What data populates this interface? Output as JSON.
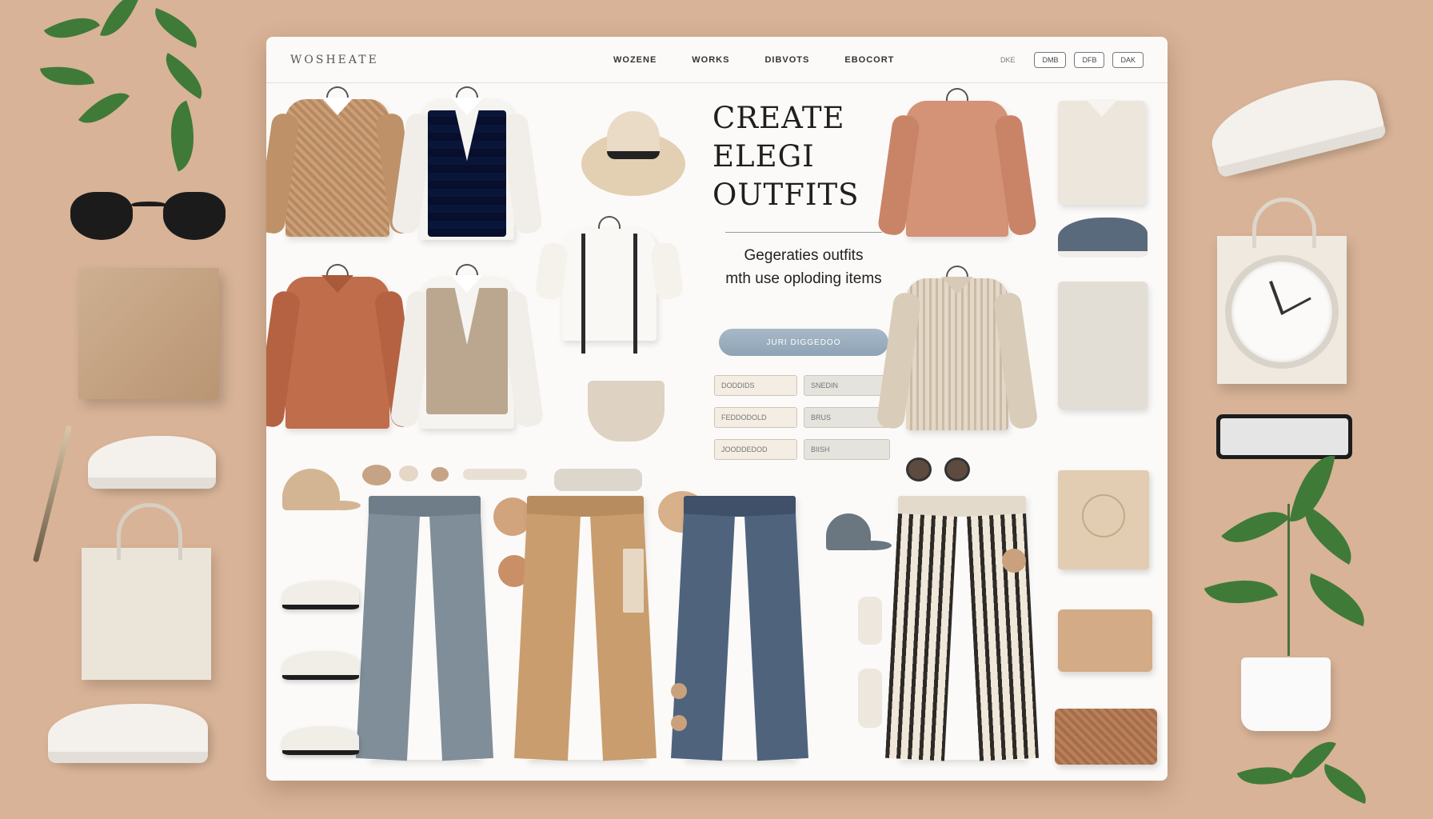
{
  "site": {
    "logo": "WOSHEATE",
    "nav_links": [
      "WOZENE",
      "WORKS",
      "DIBVOTS",
      "EBOCORT"
    ],
    "lang_label": "DKE",
    "header_buttons": [
      "DMB",
      "DFB",
      "DAK"
    ]
  },
  "hero": {
    "title_lines": [
      "CREATE",
      "ELEGI",
      "OUTFITS"
    ],
    "subtitle_lines": [
      "Gegeraties outfits",
      "mth use oploding items"
    ],
    "cta_label": "JURI DIGGEDOO"
  },
  "form": {
    "fields": [
      {
        "placeholder": "DODDIDS"
      },
      {
        "placeholder": "SNEDIN"
      },
      {
        "placeholder": "FEDDODOLD"
      },
      {
        "placeholder": "BRUS"
      },
      {
        "placeholder": "JOODDEDOD"
      },
      {
        "placeholder": "BIISH"
      }
    ]
  },
  "colors": {
    "desk": "#d8b397",
    "card": "#fbfaf8",
    "cta": "#98abbd",
    "leaf": "#3f7a38"
  },
  "icons": [
    "sunglasses-icon",
    "notebook-icon",
    "pencil-icon",
    "sneaker-icon",
    "tote-bag-icon",
    "clock-icon",
    "phone-icon",
    "plant-icon"
  ]
}
